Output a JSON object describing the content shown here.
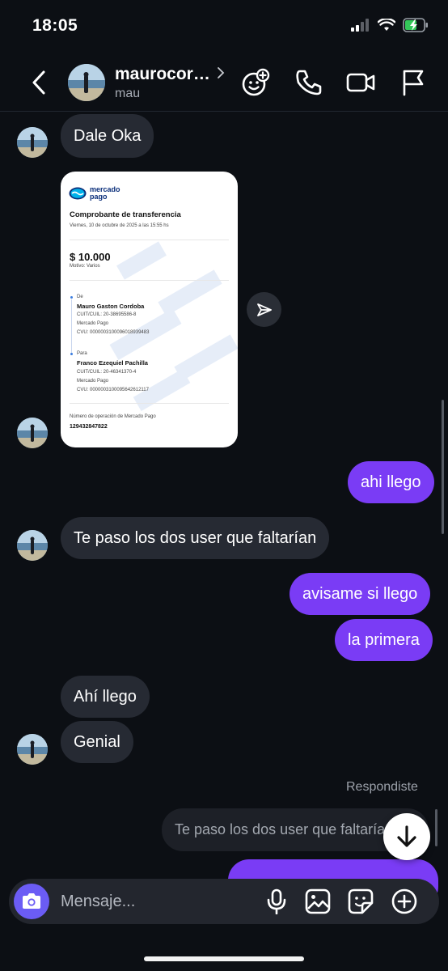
{
  "status_bar": {
    "time": "18:05"
  },
  "header": {
    "name": "maurocor…",
    "username": "mau"
  },
  "messages": [
    {
      "dir": "in",
      "text": "Dale Oka"
    },
    {
      "dir": "in",
      "type": "image"
    },
    {
      "dir": "out",
      "text": "ahi llego"
    },
    {
      "dir": "in",
      "text": "Te paso los dos user que faltarían"
    },
    {
      "dir": "out",
      "text": "avisame si llego"
    },
    {
      "dir": "out",
      "text": "la primera"
    },
    {
      "dir": "in",
      "text": "Ahí llego"
    },
    {
      "dir": "in",
      "text": "Genial"
    }
  ],
  "receipt": {
    "brand_line1": "mercado",
    "brand_line2": "pago",
    "title": "Comprobante de transferencia",
    "date": "Viernes, 10 de octubre de 2025 a las 15:55 hs",
    "amount": "$ 10.000",
    "motivo": "Motivo: Varios",
    "from_label": "De",
    "from_name": "Mauro Gaston Cordoba",
    "from_cuit": "CUIT/CUIL: 20-38695586-8",
    "from_bank": "Mercado Pago",
    "from_cvu": "CVU: 0000003100096018939483",
    "to_label": "Para",
    "to_name": "Franco Ezequiel Pachilla",
    "to_cuit": "CUIT/CUIL: 20-46341370-4",
    "to_bank": "Mercado Pago",
    "to_cvu": "CVU: 0000003100095642612117",
    "op_label": "Número de operación de Mercado Pago",
    "op_number": "129432847822"
  },
  "reply": {
    "label": "Respondiste",
    "quote": "Te paso los dos user que faltarían"
  },
  "composer": {
    "placeholder": "Mensaje..."
  },
  "colors": {
    "outgoing": "#7a3cf5",
    "incoming": "#262a33",
    "background": "#0c0f14"
  }
}
